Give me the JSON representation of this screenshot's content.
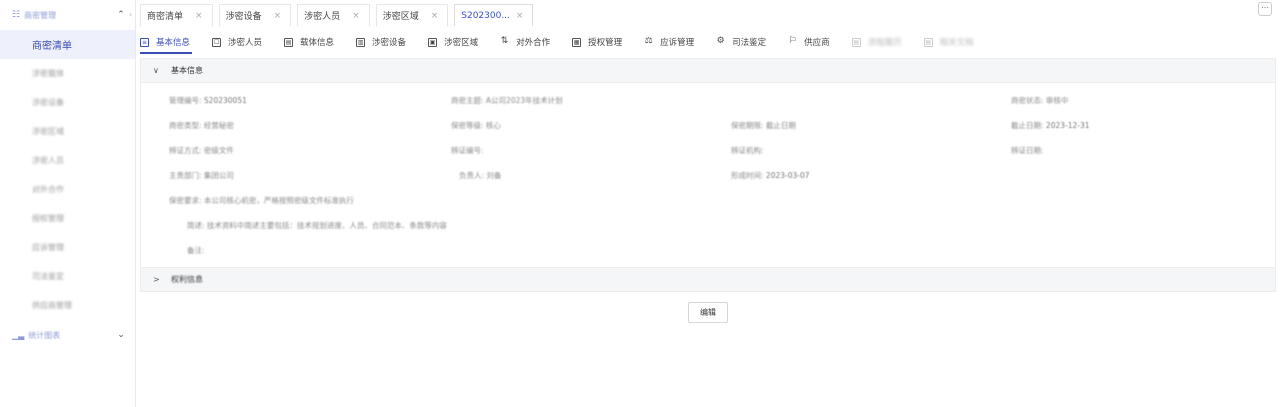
{
  "sidebar": {
    "group_top": {
      "label": "商密管理",
      "icon": "grid-icon",
      "chev": "⌃"
    },
    "items": [
      {
        "label": "商密清单",
        "active": true
      },
      {
        "label": "涉密载体"
      },
      {
        "label": "涉密设备"
      },
      {
        "label": "涉密区域"
      },
      {
        "label": "涉密人员"
      },
      {
        "label": "对外合作"
      },
      {
        "label": "授权管理"
      },
      {
        "label": "应诉管理"
      },
      {
        "label": "司法鉴定"
      },
      {
        "label": "供应商管理"
      }
    ],
    "group_bottom": {
      "label": "统计图表",
      "icon": "chart-icon",
      "chev": "⌄"
    },
    "collapse_glyph": "‹"
  },
  "tabs": [
    {
      "label": "商密清单",
      "close": "×"
    },
    {
      "label": "涉密设备",
      "close": "×"
    },
    {
      "label": "涉密人员",
      "close": "×"
    },
    {
      "label": "涉密区域",
      "close": "×"
    },
    {
      "label": "S202300...",
      "close": "×",
      "active": true
    }
  ],
  "more": "⋯",
  "subtabs": [
    {
      "label": "基本信息",
      "icon": "info-icon",
      "glyph": "≡",
      "active": true
    },
    {
      "label": "涉密人员",
      "icon": "person-icon",
      "glyph": "☐"
    },
    {
      "label": "载体信息",
      "icon": "file-icon",
      "glyph": "▤"
    },
    {
      "label": "涉密设备",
      "icon": "device-icon",
      "glyph": "▥"
    },
    {
      "label": "涉密区域",
      "icon": "area-icon",
      "glyph": "▣"
    },
    {
      "label": "对外合作",
      "icon": "swap-icon",
      "glyph": "⇅"
    },
    {
      "label": "授权管理",
      "icon": "auth-icon",
      "glyph": "▦"
    },
    {
      "label": "应诉管理",
      "icon": "case-icon",
      "glyph": "⚖"
    },
    {
      "label": "司法鉴定",
      "icon": "judge-icon",
      "glyph": "⚙"
    },
    {
      "label": "供应商",
      "icon": "supplier-icon",
      "glyph": "⚐"
    },
    {
      "label": "流程履历",
      "icon": "flow-icon",
      "glyph": "▤",
      "dim": true
    },
    {
      "label": "相关文档",
      "icon": "doc-icon",
      "glyph": "▤",
      "dim": true
    }
  ],
  "section1": {
    "arrow": "∨",
    "title": "基本信息"
  },
  "section2": {
    "arrow": ">",
    "title": "权利信息"
  },
  "fields": {
    "r1c1": {
      "label": "管理编号:",
      "value": "S20230051"
    },
    "r1c2": {
      "label": "商密主题:",
      "value": "A公司2023年技术计划"
    },
    "r1c4": {
      "label": "商密状态:",
      "value": "审核中"
    },
    "r2c1": {
      "label": "商密类型:",
      "value": "经营秘密"
    },
    "r2c2": {
      "label": "保密等级:",
      "value": "核心"
    },
    "r2c3": {
      "label": "保密期限:",
      "value": "截止日期"
    },
    "r2c4": {
      "label": "截止日期:",
      "value": "2023-12-31"
    },
    "r3c1": {
      "label": "辨证方式:",
      "value": "密级文件"
    },
    "r3c2": {
      "label": "辨证编号:",
      "value": ""
    },
    "r3c3": {
      "label": "辨证机构:",
      "value": ""
    },
    "r3c4": {
      "label": "辨证日期:",
      "value": ""
    },
    "r4c1": {
      "label": "主责部门:",
      "value": "集团公司"
    },
    "r4c2": {
      "label": "负责人:",
      "value": "刘备"
    },
    "r4c3": {
      "label": "形成时间:",
      "value": "2023-03-07"
    },
    "r5": {
      "label": "保密要求:",
      "value": "本公司核心机密，严格按照密级文件标准执行"
    },
    "r6": {
      "label": "简述:",
      "value": "技术资料中简述主要包括：技术规划进度、人员、合同范本、条款等内容"
    },
    "r7": {
      "label": "备注:",
      "value": ""
    }
  },
  "edit_button": "编辑"
}
